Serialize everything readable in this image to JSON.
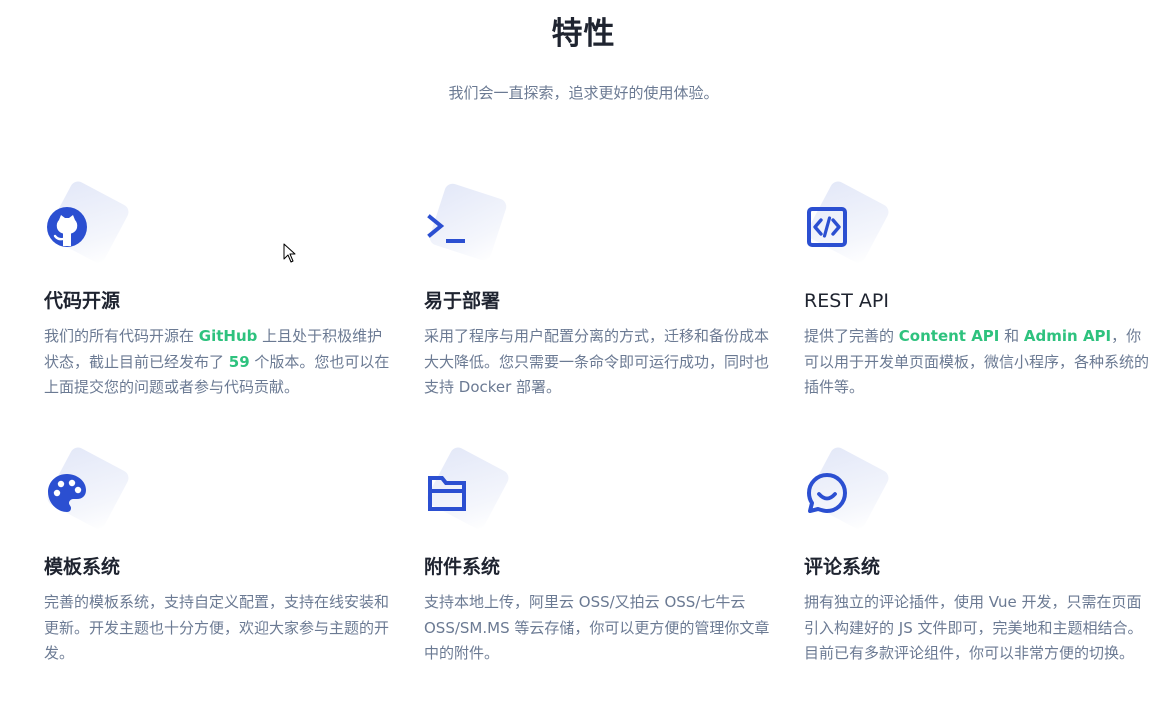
{
  "header": {
    "title": "特性",
    "subtitle": "我们会一直探索，追求更好的使用体验。"
  },
  "colors": {
    "icon": "#2b4fd1",
    "highlight": "#2ec27e",
    "text_muted": "#6b7a93",
    "title": "#1f2430"
  },
  "features": [
    {
      "icon": "github-icon",
      "title": "代码开源",
      "desc": {
        "p1": "我们的所有代码开源在 ",
        "h1": "GitHub",
        "p2": " 上且处于积极维护状态，截止目前已经发布了 ",
        "h2": "59",
        "p3": " 个版本。您也可以在上面提交您的问题或者参与代码贡献。"
      }
    },
    {
      "icon": "terminal-icon",
      "title": "易于部署",
      "desc": {
        "p1": "采用了程序与用户配置分离的方式，迁移和备份成本大大降低。您只需要一条命令即可运行成功，同时也支持 Docker 部署。"
      }
    },
    {
      "icon": "code-icon",
      "title": "REST API",
      "desc": {
        "p1": "提供了完善的 ",
        "h1": "Content API",
        "p2": " 和 ",
        "h2": "Admin API",
        "p3": "，你可以用于开发单页面模板，微信小程序，各种系统的插件等。"
      }
    },
    {
      "icon": "palette-icon",
      "title": "模板系统",
      "desc": {
        "p1": "完善的模板系统，支持自定义配置，支持在线安装和更新。开发主题也十分方便，欢迎大家参与主题的开发。"
      }
    },
    {
      "icon": "folder-icon",
      "title": "附件系统",
      "desc": {
        "p1": "支持本地上传，阿里云 OSS/又拍云 OSS/七牛云 OSS/SM.MS 等云存储，你可以更方便的管理你文章中的附件。"
      }
    },
    {
      "icon": "comment-icon",
      "title": "评论系统",
      "desc": {
        "p1": "拥有独立的评论插件，使用 Vue 开发，只需在页面引入构建好的 JS 文件即可，完美地和主题相结合。目前已有多款评论组件，你可以非常方便的切换。"
      }
    }
  ]
}
